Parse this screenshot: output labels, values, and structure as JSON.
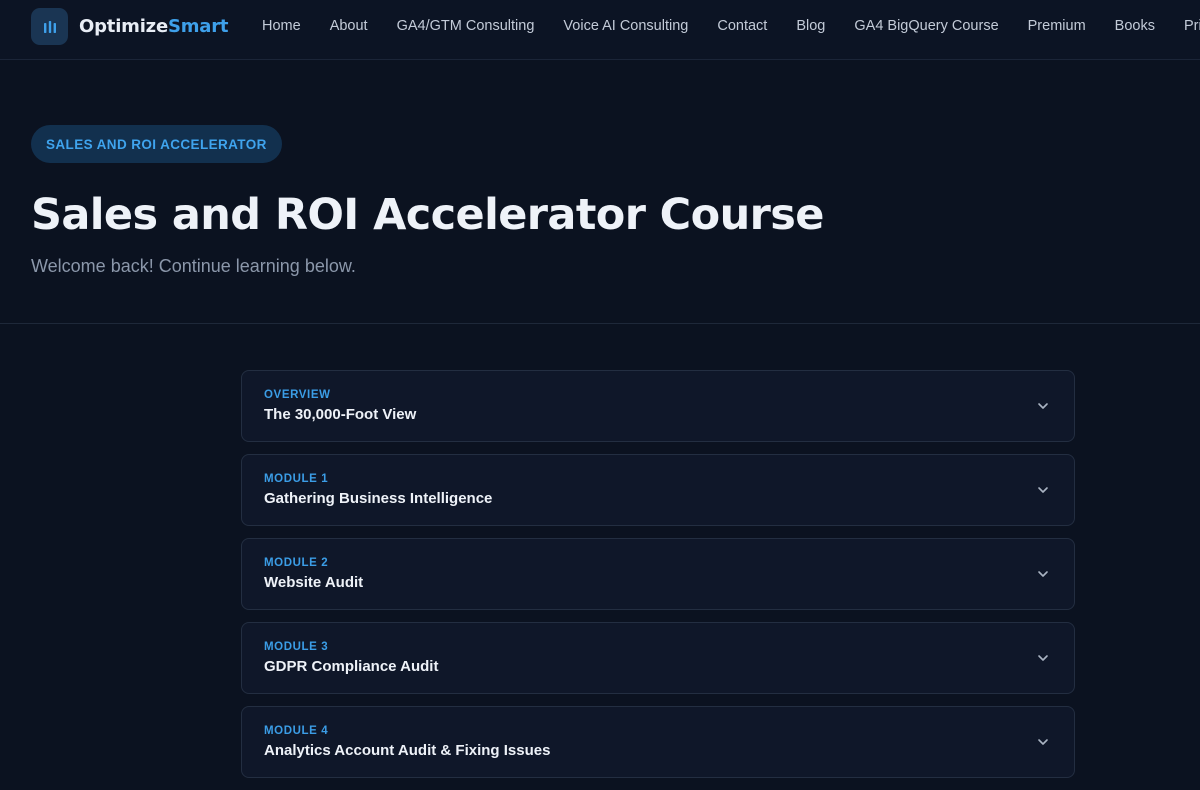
{
  "header": {
    "logo": {
      "part_a": "Optimize",
      "part_b": "Smart",
      "icon": "bar-chart-icon"
    },
    "nav": [
      {
        "label": "Home"
      },
      {
        "label": "About"
      },
      {
        "label": "GA4/GTM Consulting"
      },
      {
        "label": "Voice AI Consulting"
      },
      {
        "label": "Contact"
      },
      {
        "label": "Blog"
      },
      {
        "label": "GA4 BigQuery Course"
      },
      {
        "label": "Premium"
      },
      {
        "label": "Books"
      },
      {
        "label": "Priva"
      }
    ]
  },
  "hero": {
    "badge": "SALES AND ROI ACCELERATOR",
    "title": "Sales and ROI Accelerator Course",
    "subtitle": "Welcome back! Continue learning below."
  },
  "modules": [
    {
      "label": "OVERVIEW",
      "title": "The 30,000-Foot View"
    },
    {
      "label": "MODULE 1",
      "title": "Gathering Business Intelligence"
    },
    {
      "label": "MODULE 2",
      "title": "Website Audit"
    },
    {
      "label": "MODULE 3",
      "title": "GDPR Compliance Audit"
    },
    {
      "label": "MODULE 4",
      "title": "Analytics Account Audit & Fixing Issues"
    }
  ],
  "colors": {
    "accent": "#3ea0ea",
    "background": "#0b1220",
    "card": "#0f1729"
  }
}
